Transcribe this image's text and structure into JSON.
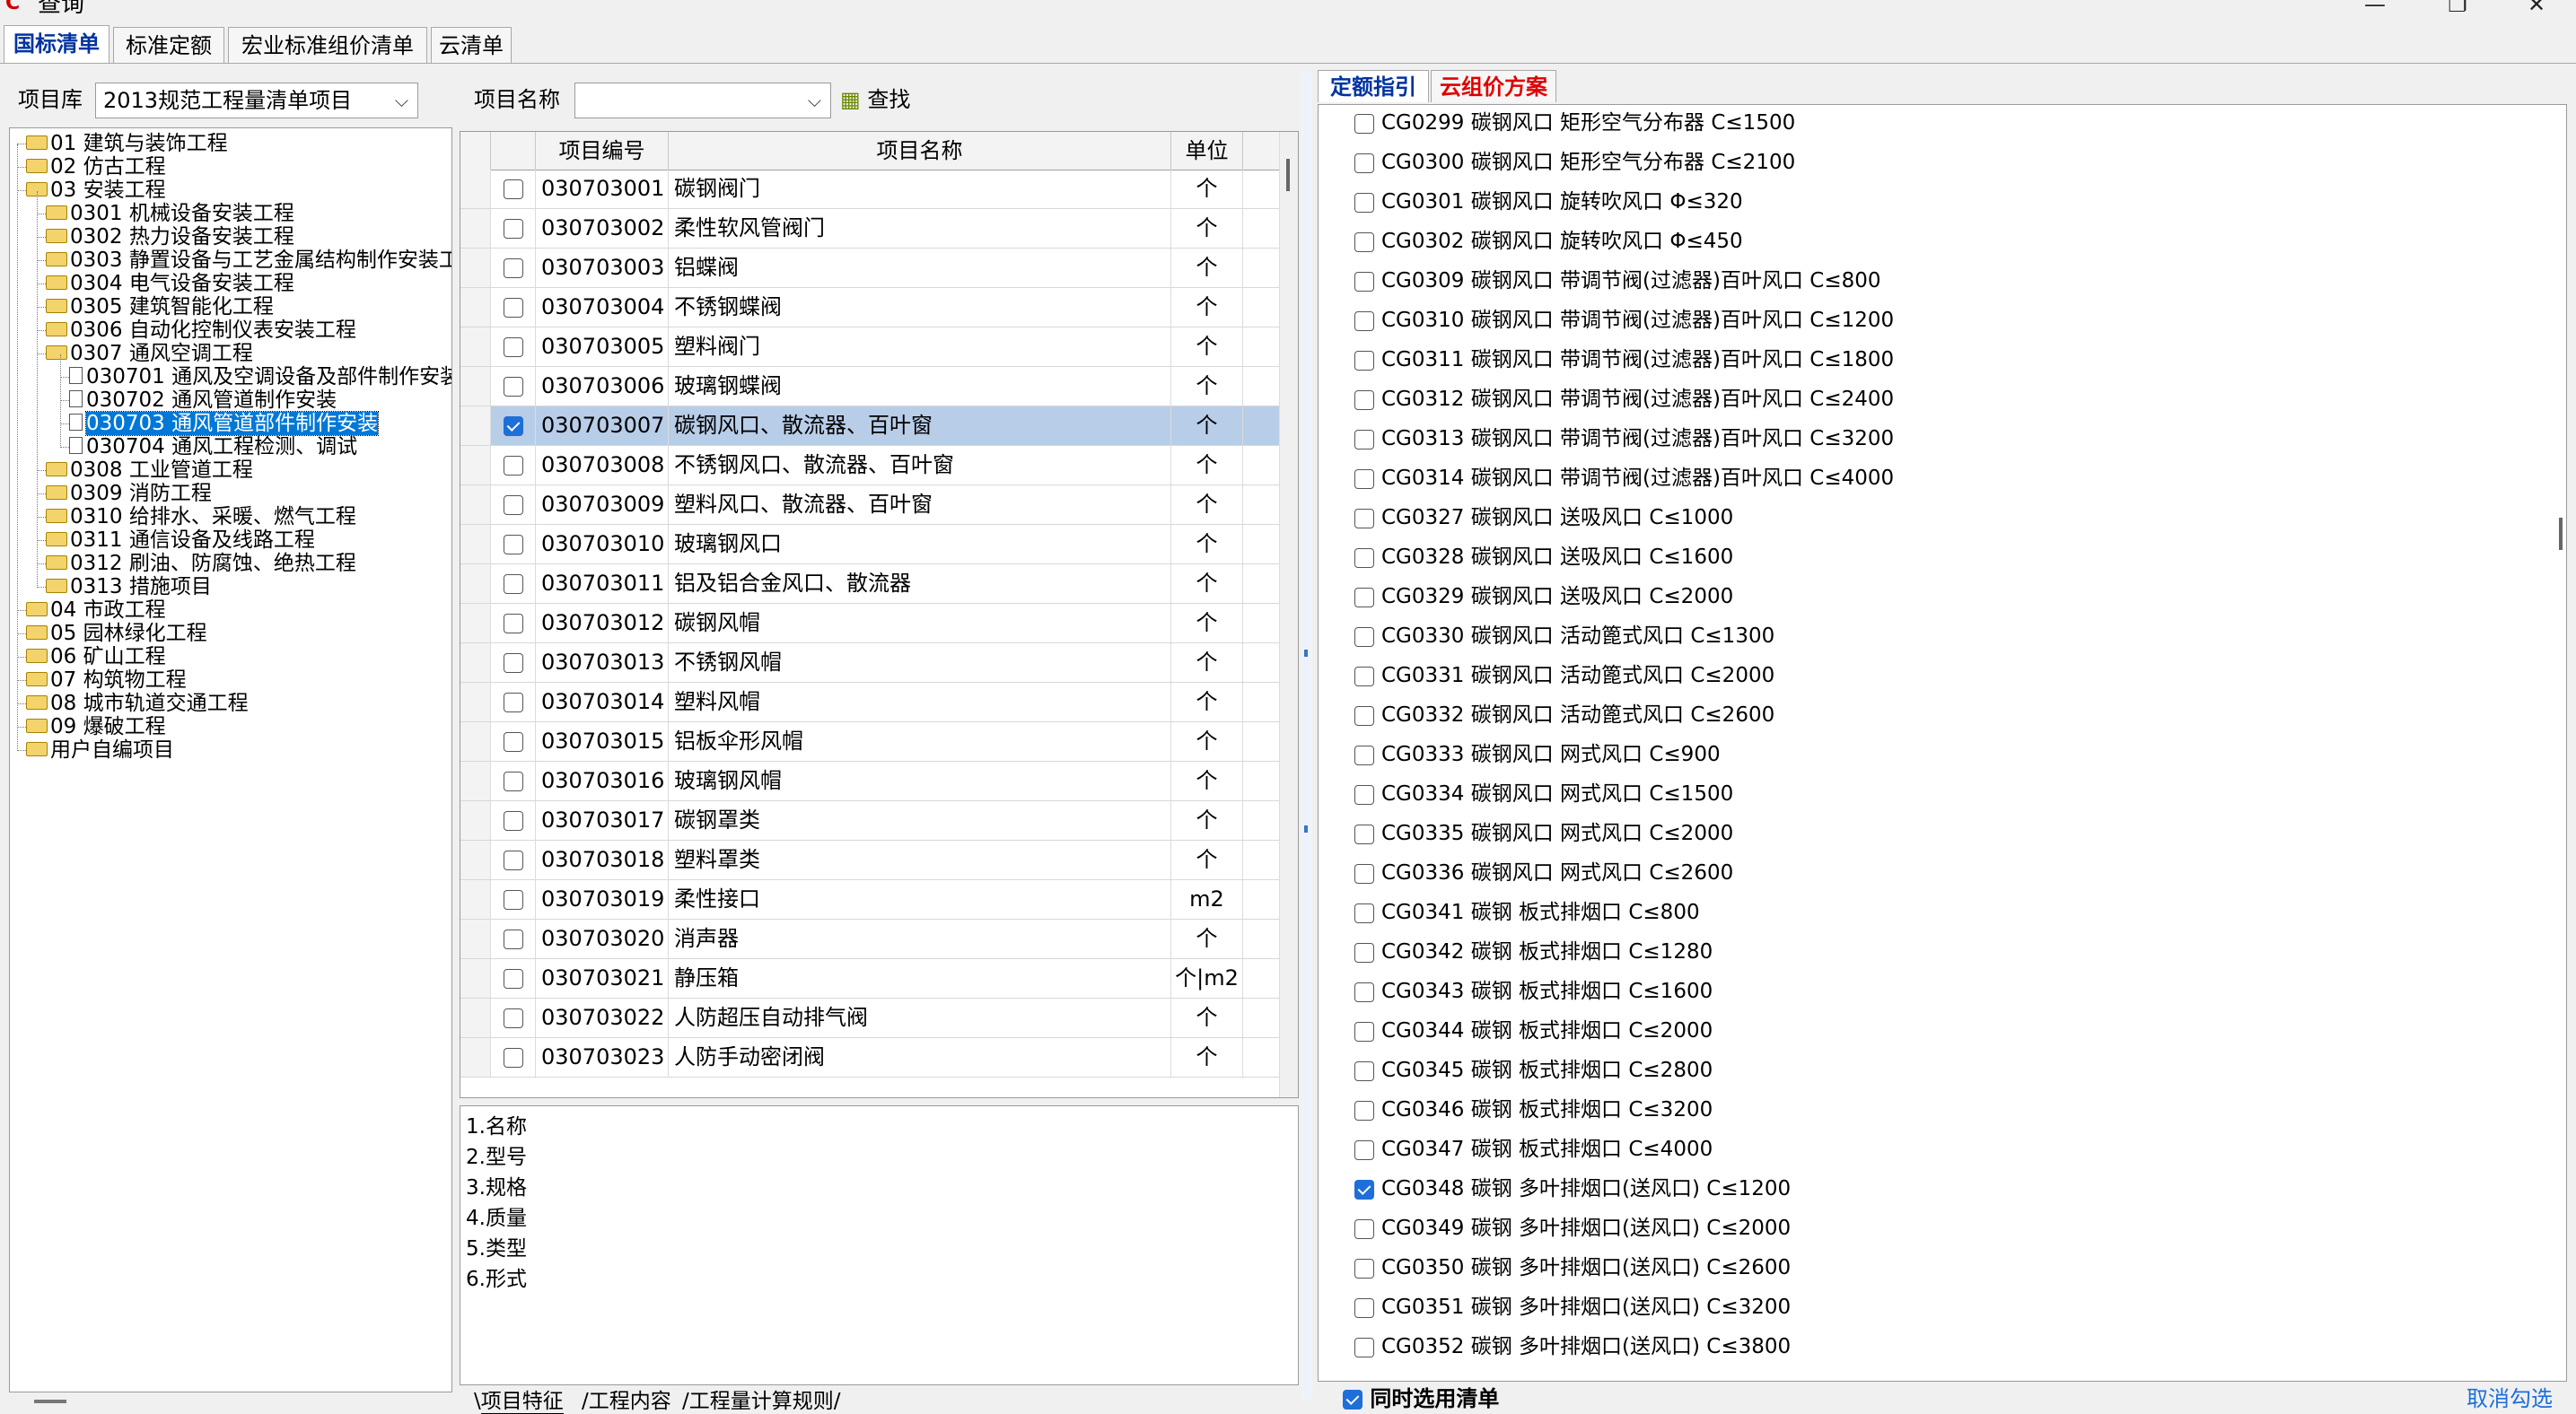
{
  "window": {
    "title": "查询",
    "icon": "app-logo-icon"
  },
  "tabs": [
    "国标清单",
    "标准定额",
    "宏业标准组价清单",
    "云清单"
  ],
  "active_tab": 0,
  "library": {
    "label": "项目库",
    "value": "2013规范工程量清单项目"
  },
  "search": {
    "label": "项目名称",
    "value": "",
    "button": "查找"
  },
  "tree": [
    {
      "label": "01 建筑与装饰工程",
      "level": 0,
      "type": "folder"
    },
    {
      "label": "02 仿古工程",
      "level": 0,
      "type": "folder"
    },
    {
      "label": "03 安装工程",
      "level": 0,
      "type": "folder-open"
    },
    {
      "label": "0301 机械设备安装工程",
      "level": 1,
      "type": "folder"
    },
    {
      "label": "0302 热力设备安装工程",
      "level": 1,
      "type": "folder"
    },
    {
      "label": "0303 静置设备与工艺金属结构制作安装工",
      "level": 1,
      "type": "folder"
    },
    {
      "label": "0304 电气设备安装工程",
      "level": 1,
      "type": "folder"
    },
    {
      "label": "0305 建筑智能化工程",
      "level": 1,
      "type": "folder"
    },
    {
      "label": "0306 自动化控制仪表安装工程",
      "level": 1,
      "type": "folder"
    },
    {
      "label": "0307 通风空调工程",
      "level": 1,
      "type": "folder-open"
    },
    {
      "label": "030701 通风及空调设备及部件制作安装",
      "level": 2,
      "type": "doc"
    },
    {
      "label": "030702 通风管道制作安装",
      "level": 2,
      "type": "doc"
    },
    {
      "label": "030703 通风管道部件制作安装",
      "level": 2,
      "type": "doc",
      "selected": true
    },
    {
      "label": "030704 通风工程检测、调试",
      "level": 2,
      "type": "doc"
    },
    {
      "label": "0308 工业管道工程",
      "level": 1,
      "type": "folder"
    },
    {
      "label": "0309 消防工程",
      "level": 1,
      "type": "folder"
    },
    {
      "label": "0310 给排水、采暖、燃气工程",
      "level": 1,
      "type": "folder"
    },
    {
      "label": "0311 通信设备及线路工程",
      "level": 1,
      "type": "folder"
    },
    {
      "label": "0312 刷油、防腐蚀、绝热工程",
      "level": 1,
      "type": "folder"
    },
    {
      "label": "0313 措施项目",
      "level": 1,
      "type": "folder"
    },
    {
      "label": "04 市政工程",
      "level": 0,
      "type": "folder"
    },
    {
      "label": "05 园林绿化工程",
      "level": 0,
      "type": "folder"
    },
    {
      "label": "06 矿山工程",
      "level": 0,
      "type": "folder"
    },
    {
      "label": "07 构筑物工程",
      "level": 0,
      "type": "folder"
    },
    {
      "label": "08 城市轨道交通工程",
      "level": 0,
      "type": "folder"
    },
    {
      "label": "09 爆破工程",
      "level": 0,
      "type": "folder"
    },
    {
      "label": "用户自编项目",
      "level": 0,
      "type": "folder"
    }
  ],
  "grid": {
    "headers": [
      "项目编号",
      "项目名称",
      "单位"
    ],
    "rows": [
      {
        "checked": false,
        "code": "030703001",
        "name": "碳钢阀门",
        "unit": "个"
      },
      {
        "checked": false,
        "code": "030703002",
        "name": "柔性软风管阀门",
        "unit": "个"
      },
      {
        "checked": false,
        "code": "030703003",
        "name": "铝蝶阀",
        "unit": "个"
      },
      {
        "checked": false,
        "code": "030703004",
        "name": "不锈钢蝶阀",
        "unit": "个"
      },
      {
        "checked": false,
        "code": "030703005",
        "name": "塑料阀门",
        "unit": "个"
      },
      {
        "checked": false,
        "code": "030703006",
        "name": "玻璃钢蝶阀",
        "unit": "个"
      },
      {
        "checked": true,
        "code": "030703007",
        "name": "碳钢风口、散流器、百叶窗",
        "unit": "个",
        "selected": true
      },
      {
        "checked": false,
        "code": "030703008",
        "name": "不锈钢风口、散流器、百叶窗",
        "unit": "个"
      },
      {
        "checked": false,
        "code": "030703009",
        "name": "塑料风口、散流器、百叶窗",
        "unit": "个"
      },
      {
        "checked": false,
        "code": "030703010",
        "name": "玻璃钢风口",
        "unit": "个"
      },
      {
        "checked": false,
        "code": "030703011",
        "name": "铝及铝合金风口、散流器",
        "unit": "个"
      },
      {
        "checked": false,
        "code": "030703012",
        "name": "碳钢风帽",
        "unit": "个"
      },
      {
        "checked": false,
        "code": "030703013",
        "name": "不锈钢风帽",
        "unit": "个"
      },
      {
        "checked": false,
        "code": "030703014",
        "name": "塑料风帽",
        "unit": "个"
      },
      {
        "checked": false,
        "code": "030703015",
        "name": "铝板伞形风帽",
        "unit": "个"
      },
      {
        "checked": false,
        "code": "030703016",
        "name": "玻璃钢风帽",
        "unit": "个"
      },
      {
        "checked": false,
        "code": "030703017",
        "name": "碳钢罩类",
        "unit": "个"
      },
      {
        "checked": false,
        "code": "030703018",
        "name": "塑料罩类",
        "unit": "个"
      },
      {
        "checked": false,
        "code": "030703019",
        "name": "柔性接口",
        "unit": "m2"
      },
      {
        "checked": false,
        "code": "030703020",
        "name": "消声器",
        "unit": "个"
      },
      {
        "checked": false,
        "code": "030703021",
        "name": "静压箱",
        "unit": "个|m2"
      },
      {
        "checked": false,
        "code": "030703022",
        "name": "人防超压自动排气阀",
        "unit": "个"
      },
      {
        "checked": false,
        "code": "030703023",
        "name": "人防手动密闭阀",
        "unit": "个"
      }
    ]
  },
  "features": [
    "1.名称",
    "2.型号",
    "3.规格",
    "4.质量",
    "5.类型",
    "6.形式"
  ],
  "bottom_tabs": [
    "项目特征",
    "工程内容",
    "工程量计算规则"
  ],
  "right_tabs": [
    "定额指引",
    "云组价方案"
  ],
  "quota_list": [
    {
      "checked": false,
      "text": "CG0299 碳钢风口 矩形空气分布器 C≤1500"
    },
    {
      "checked": false,
      "text": "CG0300 碳钢风口 矩形空气分布器 C≤2100"
    },
    {
      "checked": false,
      "text": "CG0301 碳钢风口 旋转吹风口 Φ≤320"
    },
    {
      "checked": false,
      "text": "CG0302 碳钢风口 旋转吹风口 Φ≤450"
    },
    {
      "checked": false,
      "text": "CG0309 碳钢风口 带调节阀(过滤器)百叶风口 C≤800"
    },
    {
      "checked": false,
      "text": "CG0310 碳钢风口 带调节阀(过滤器)百叶风口 C≤1200"
    },
    {
      "checked": false,
      "text": "CG0311 碳钢风口 带调节阀(过滤器)百叶风口 C≤1800"
    },
    {
      "checked": false,
      "text": "CG0312 碳钢风口 带调节阀(过滤器)百叶风口 C≤2400"
    },
    {
      "checked": false,
      "text": "CG0313 碳钢风口 带调节阀(过滤器)百叶风口 C≤3200"
    },
    {
      "checked": false,
      "text": "CG0314 碳钢风口 带调节阀(过滤器)百叶风口 C≤4000"
    },
    {
      "checked": false,
      "text": "CG0327 碳钢风口 送吸风口 C≤1000"
    },
    {
      "checked": false,
      "text": "CG0328 碳钢风口 送吸风口 C≤1600"
    },
    {
      "checked": false,
      "text": "CG0329 碳钢风口 送吸风口 C≤2000"
    },
    {
      "checked": false,
      "text": "CG0330 碳钢风口 活动篦式风口 C≤1300"
    },
    {
      "checked": false,
      "text": "CG0331 碳钢风口 活动篦式风口 C≤2000"
    },
    {
      "checked": false,
      "text": "CG0332 碳钢风口 活动篦式风口 C≤2600"
    },
    {
      "checked": false,
      "text": "CG0333 碳钢风口 网式风口 C≤900"
    },
    {
      "checked": false,
      "text": "CG0334 碳钢风口 网式风口 C≤1500"
    },
    {
      "checked": false,
      "text": "CG0335 碳钢风口 网式风口 C≤2000"
    },
    {
      "checked": false,
      "text": "CG0336 碳钢风口 网式风口 C≤2600"
    },
    {
      "checked": false,
      "text": "CG0341 碳钢 板式排烟口 C≤800"
    },
    {
      "checked": false,
      "text": "CG0342 碳钢 板式排烟口 C≤1280"
    },
    {
      "checked": false,
      "text": "CG0343 碳钢 板式排烟口 C≤1600"
    },
    {
      "checked": false,
      "text": "CG0344 碳钢 板式排烟口 C≤2000"
    },
    {
      "checked": false,
      "text": "CG0345 碳钢 板式排烟口 C≤2800"
    },
    {
      "checked": false,
      "text": "CG0346 碳钢 板式排烟口 C≤3200"
    },
    {
      "checked": false,
      "text": "CG0347 碳钢 板式排烟口 C≤4000"
    },
    {
      "checked": true,
      "text": "CG0348 碳钢 多叶排烟口(送风口) C≤1200"
    },
    {
      "checked": false,
      "text": "CG0349 碳钢 多叶排烟口(送风口) C≤2000"
    },
    {
      "checked": false,
      "text": "CG0350 碳钢 多叶排烟口(送风口) C≤2600"
    },
    {
      "checked": false,
      "text": "CG0351 碳钢 多叶排烟口(送风口) C≤3200"
    },
    {
      "checked": false,
      "text": "CG0352 碳钢 多叶排烟口(送风口) C≤3800"
    }
  ],
  "bottom_check": {
    "label": "同时选用清单",
    "checked": true
  },
  "cancel_check": "取消勾选",
  "colors": {
    "accent": "#0078d7",
    "tab_active": "#0033a0",
    "cloud_tab": "#e00000",
    "row_selected": "#b8cde8"
  }
}
